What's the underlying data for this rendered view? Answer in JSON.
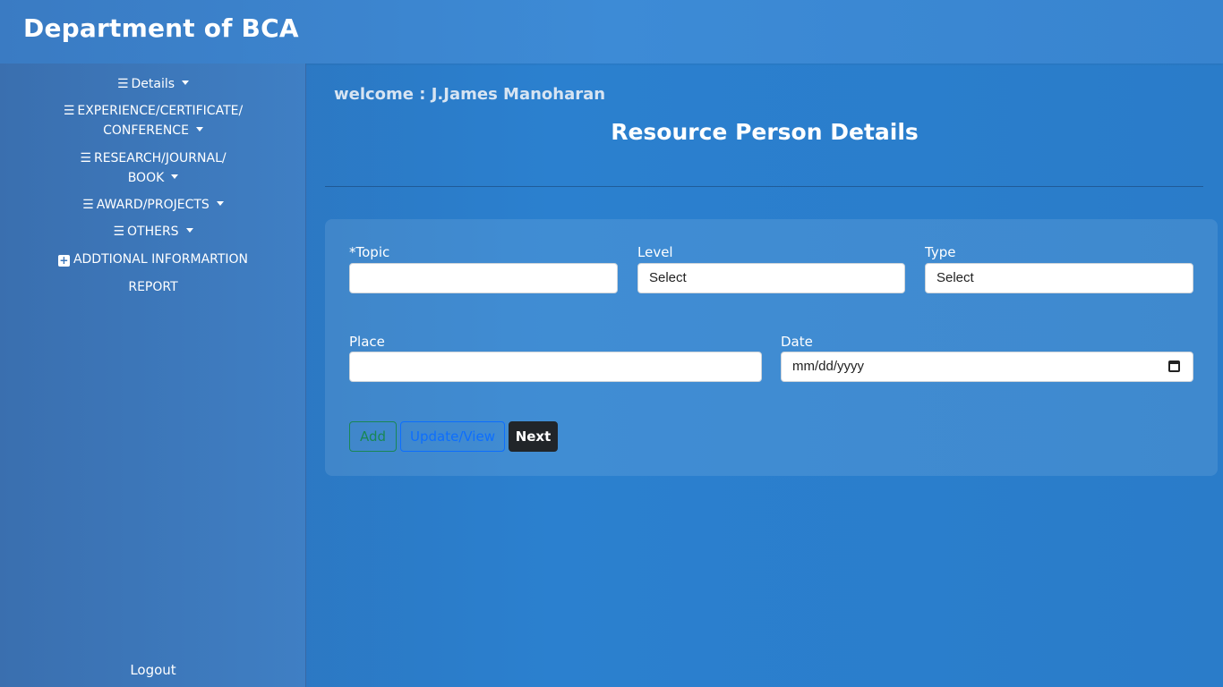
{
  "header": {
    "title": "Department of BCA"
  },
  "sidebar": {
    "items": [
      {
        "label": "Details"
      },
      {
        "label_line1": "EXPERIENCE/CERTIFICATE/",
        "label_line2": "CONFERENCE"
      },
      {
        "label_line1": "RESEARCH/JOURNAL/",
        "label_line2": "BOOK"
      },
      {
        "label": "AWARD/PROJECTS"
      },
      {
        "label": "OTHERS"
      },
      {
        "label": "ADDTIONAL INFORMARTION"
      },
      {
        "label": "REPORT"
      }
    ],
    "logout": "Logout"
  },
  "main": {
    "welcome": "welcome : J.James Manoharan",
    "title": "Resource Person Details",
    "form": {
      "topic_label": "*Topic",
      "topic_value": "",
      "level_label": "Level",
      "level_value": "Select",
      "type_label": "Type",
      "type_value": "Select",
      "place_label": "Place",
      "place_value": "",
      "date_label": "Date",
      "date_placeholder": "mm/dd/yyyy"
    },
    "buttons": {
      "add": "Add",
      "update": "Update/View",
      "next": "Next"
    }
  },
  "colors": {
    "add": "#198754",
    "update": "#0d6efd",
    "next": "#212529"
  },
  "icons": {
    "menu": "hamburger-icon",
    "caret": "caret-down-icon",
    "plus": "plus-square-icon",
    "calendar": "calendar-icon"
  }
}
